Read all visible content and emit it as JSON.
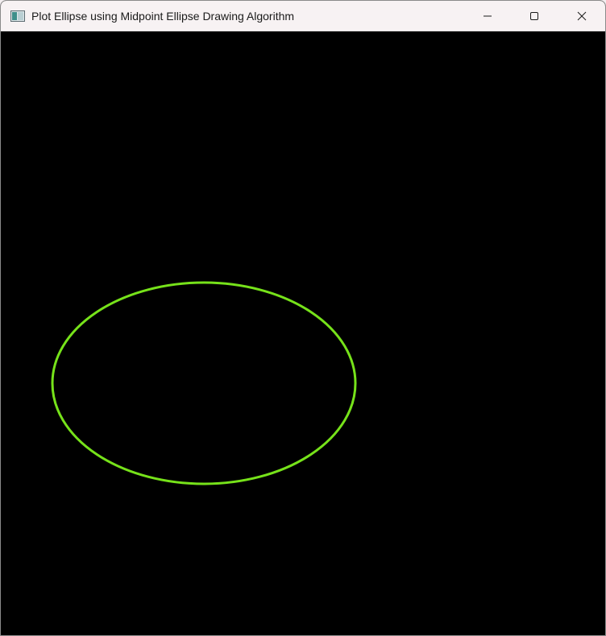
{
  "window": {
    "title": "Plot Ellipse using Midpoint Ellipse Drawing Algorithm",
    "controls": {
      "minimize_icon": "minimize-icon",
      "maximize_icon": "maximize-icon",
      "close_icon": "close-icon"
    }
  },
  "canvas": {
    "background": "#000000",
    "ellipse": {
      "color": "#76e21a"
    }
  }
}
